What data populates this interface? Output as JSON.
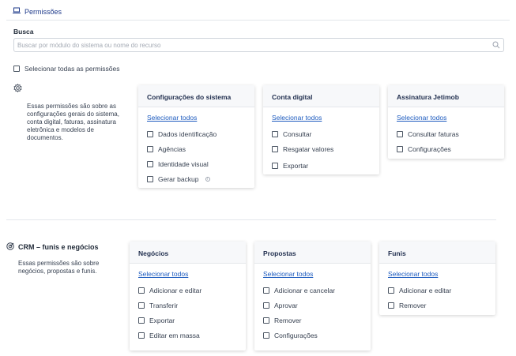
{
  "header": {
    "title": "Permissões"
  },
  "search": {
    "label": "Busca",
    "placeholder": "Buscar por módulo do sistema ou nome do recurso",
    "value": ""
  },
  "select_all": {
    "label": "Selecionar todas as permissões"
  },
  "sections": [
    {
      "title": "",
      "description": "Essas permissões são sobre as configurações gerais do sistema, conta digital, faturas, assinatura eletrônica e modelos de documentos.",
      "cards": [
        {
          "title": "Configurações do sistema",
          "link": "Selecionar todos",
          "items": [
            "Dados identificação",
            "Agências",
            "Identidade visual",
            "Gerar backup"
          ]
        },
        {
          "title": "Conta digital",
          "link": "Selecionar todos",
          "items": [
            "Consultar",
            "Resgatar valores",
            "Exportar"
          ]
        },
        {
          "title": "Assinatura Jetimob",
          "link": "Selecionar todos",
          "items": [
            "Consultar faturas",
            "Configurações"
          ]
        }
      ]
    },
    {
      "title": "CRM – funis e negócios",
      "description": "Essas permissões são sobre negócios, propostas e funis.",
      "cards": [
        {
          "title": "Negócios",
          "link": "Selecionar todos",
          "items": [
            "Adicionar e editar",
            "Transferir",
            "Exportar",
            "Editar em massa"
          ]
        },
        {
          "title": "Propostas",
          "link": "Selecionar todos",
          "items": [
            "Adicionar e cancelar",
            "Aprovar",
            "Remover",
            "Configurações"
          ]
        },
        {
          "title": "Funis",
          "link": "Selecionar todos",
          "items": [
            "Adicionar e editar",
            "Remover"
          ]
        }
      ]
    }
  ],
  "colors": {
    "accent": "#1d5bbf",
    "title": "#1e3a8a",
    "border": "#cfd4db"
  }
}
